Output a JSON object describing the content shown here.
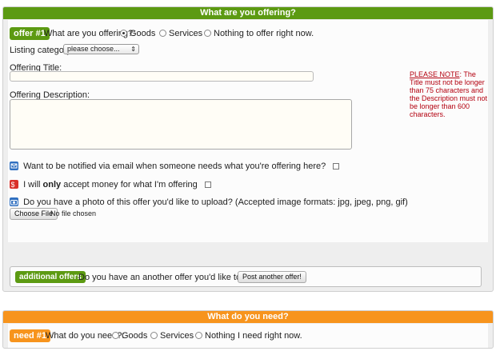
{
  "offer_section": {
    "header": "What are you offering?",
    "badge": "offer  #1",
    "question": "What are you offering?:",
    "radio_options": [
      "Goods",
      "Services",
      "Nothing to offer right now."
    ],
    "selected_option": "Goods",
    "listing_category_label": "Listing category:",
    "listing_category_value": "please choose...",
    "title_label": "Offering Title:",
    "title_value": "",
    "description_label": "Offering Description:",
    "description_value": "",
    "note_heading": "PLEASE NOTE",
    "note_text": "The Title must not be longer than 75 characters and the Description must not be longer than 600 characters.",
    "notify_label": "Want to be notified via email when someone needs what you're offering here?",
    "money_prefix": "I will ",
    "money_bold": "only",
    "money_suffix": " accept money for what I'm offering",
    "photo_label": "Do you have a photo of this offer you'd like to upload?  (Accepted image formats: jpg, jpeg, png, gif)",
    "choose_file_label": "Choose File",
    "no_file_label": "No file chosen",
    "additional_badge": "additional offers",
    "additional_question": "Do you have an another offer you'd like to post?",
    "post_another_label": "Post another offer!"
  },
  "need_section": {
    "header": "What do you need?",
    "badge": "need  #1",
    "question": "What do you need?:",
    "radio_options": [
      "Goods",
      "Services",
      "Nothing I need right now."
    ]
  },
  "colors": {
    "offer_header": "#5c9a12",
    "need_header": "#f7941d",
    "note_text": "#b3000f"
  },
  "icons": {
    "notify": "envelope-icon",
    "money": "money-icon",
    "photo": "camera-icon"
  }
}
